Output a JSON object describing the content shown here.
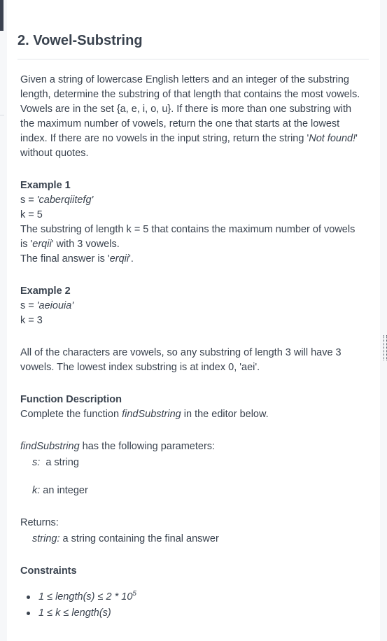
{
  "problem": {
    "title": "2. Vowel-Substring",
    "statement": "Given a string of lowercase English letters and an integer of the substring length, determine the substring of that length that contains the most vowels. Vowels are in the set {a, e, i, o, u}. If there is more than one substring with the maximum number of vowels, return the one that starts at the lowest index. If there are no vowels in the input string, return the string '",
    "statement_italic": "Not found!",
    "statement_tail": "' without quotes."
  },
  "example1": {
    "heading": "Example 1",
    "s_prefix": "s = ",
    "s_value": "'caberqiitefg'",
    "k_line": "k = 5",
    "explain1": "The substring of length k = 5 that contains the maximum number of vowels is '",
    "explain_italic": "erqii",
    "explain2": "' with 3 vowels.",
    "final_prefix": "The final answer is '",
    "final_value": "erqii",
    "final_suffix": "'."
  },
  "example2": {
    "heading": "Example 2",
    "s_prefix": "s = ",
    "s_value": "'aeiouia'",
    "k_line": "k = 3",
    "explain": "All of the characters are vowels, so any substring of length 3 will have 3 vowels. The lowest index substring is at index 0, 'aei'."
  },
  "function_description": {
    "heading": "Function Description",
    "text_prefix": "Complete the function ",
    "function_name": "findSubstring",
    "text_suffix": " in the editor below.",
    "params_name": "findSubstring",
    "params_suffix": " has the following parameters:",
    "param_s_name": "s:",
    "param_s_desc": "  a string",
    "param_k_name": "k:",
    "param_k_desc": " an integer",
    "returns_label": "Returns:",
    "returns_type": "string:",
    "returns_desc": " a string containing the final answer"
  },
  "constraints": {
    "heading": "Constraints",
    "c1_text": "1 ≤ length(s) ≤ 2 * 10",
    "c1_exp": "5",
    "c2_text": "1 ≤ k ≤ length(s)"
  }
}
